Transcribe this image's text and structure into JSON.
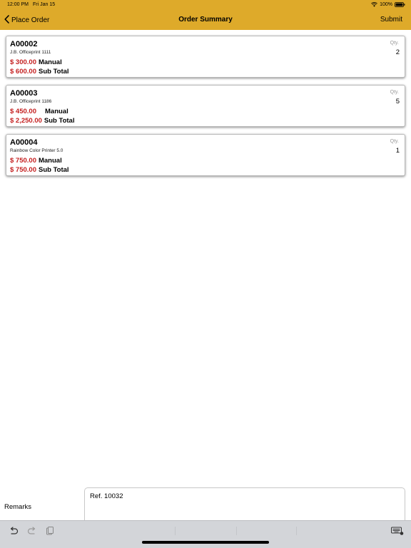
{
  "status_bar": {
    "time": "12:00 PM",
    "date": "Fri Jan 15",
    "battery": "100%"
  },
  "nav": {
    "back_label": "Place Order",
    "title": "Order Summary",
    "submit_label": "Submit"
  },
  "orders": [
    {
      "code": "A00002",
      "description": "J.B. Officeprint 1111",
      "price": "$ 300.00",
      "price_type": "Manual",
      "subtotal": "$ 600.00",
      "subtotal_label": "Sub Total",
      "qty_label": "Qty.",
      "qty": "2"
    },
    {
      "code": "A00003",
      "description": "J.B. Officeprint 1186",
      "price": "$ 450.00",
      "price_type": "Manual",
      "subtotal": "$ 2,250.00",
      "subtotal_label": "Sub Total",
      "qty_label": "Qty.",
      "qty": "5"
    },
    {
      "code": "A00004",
      "description": "Rainbow Color Printer 5.0",
      "price": "$ 750.00",
      "price_type": "Manual",
      "subtotal": "$ 750.00",
      "subtotal_label": "Sub Total",
      "qty_label": "Qty.",
      "qty": "1"
    }
  ],
  "remarks": {
    "label": "Remarks",
    "value": "Ref. 10032"
  },
  "keyboard_toolbar": {
    "icons": [
      "undo-icon",
      "redo-icon",
      "paste-icon",
      "keyboard-icon"
    ]
  },
  "colors": {
    "header": "#deaa2a",
    "price": "#c41f1f",
    "qty_label": "#9c9c9c"
  }
}
